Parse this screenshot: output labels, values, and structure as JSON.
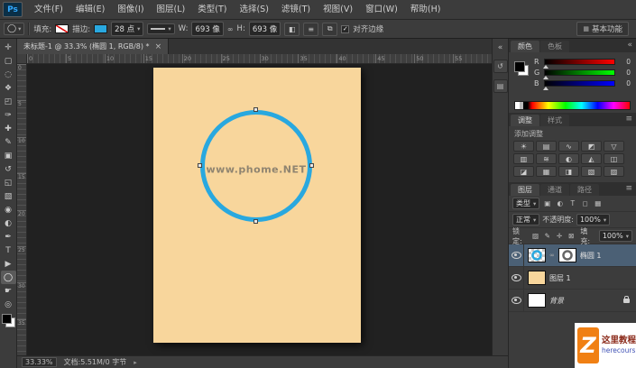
{
  "app": {
    "logo": "Ps",
    "workspace": "基本功能"
  },
  "menu": {
    "items": [
      "文件(F)",
      "编辑(E)",
      "图像(I)",
      "图层(L)",
      "类型(T)",
      "选择(S)",
      "滤镜(T)",
      "视图(V)",
      "窗口(W)",
      "帮助(H)"
    ]
  },
  "options": {
    "fill_label": "填充:",
    "stroke_label": "描边:",
    "stroke_width": "28 点",
    "w_label": "W:",
    "w_value": "693 像",
    "h_label": "H:",
    "h_value": "693 像",
    "align_edges": "对齐边缘"
  },
  "icons": {
    "dropdown": "▾",
    "collapse": "«",
    "menu": "≡",
    "check": "✓",
    "link": "∞",
    "close": "×",
    "arrow_right": "▸",
    "workspace": "▦",
    "ellipse_tool": "◯",
    "path_ops": "◧",
    "path_align": "≡",
    "path_arrange": "⧉"
  },
  "toolbar": {
    "tools": [
      {
        "name": "move",
        "glyph": "✛"
      },
      {
        "name": "rectangular-marquee",
        "glyph": "▢"
      },
      {
        "name": "lasso",
        "glyph": "◌"
      },
      {
        "name": "quick-selection",
        "glyph": "❖"
      },
      {
        "name": "crop",
        "glyph": "◰"
      },
      {
        "name": "eyedropper",
        "glyph": "✑"
      },
      {
        "name": "spot-healing-brush",
        "glyph": "✚"
      },
      {
        "name": "brush",
        "glyph": "✎"
      },
      {
        "name": "clone-stamp",
        "glyph": "▣"
      },
      {
        "name": "history-brush",
        "glyph": "↺"
      },
      {
        "name": "eraser",
        "glyph": "◱"
      },
      {
        "name": "gradient",
        "glyph": "▧"
      },
      {
        "name": "blur",
        "glyph": "◉"
      },
      {
        "name": "dodge",
        "glyph": "◐"
      },
      {
        "name": "pen",
        "glyph": "✒"
      },
      {
        "name": "horizontal-type",
        "glyph": "T"
      },
      {
        "name": "path-selection",
        "glyph": "▶"
      },
      {
        "name": "ellipse-shape",
        "glyph": "◯"
      },
      {
        "name": "hand",
        "glyph": "☛"
      },
      {
        "name": "zoom",
        "glyph": "◎"
      }
    ]
  },
  "doc": {
    "tab_title": "未标题-1 @ 33.3% (椭圆 1, RGB/8) *",
    "watermark": "www.phome.NET",
    "ruler_top": [
      "0",
      "5",
      "10",
      "15",
      "20",
      "25",
      "30",
      "35",
      "40",
      "45",
      "50",
      "55"
    ],
    "ruler_left": [
      "0",
      "5",
      "10",
      "15",
      "20",
      "25",
      "30",
      "35"
    ]
  },
  "strip": {
    "icons": [
      {
        "name": "collapse-dock",
        "glyph": "«"
      },
      {
        "name": "history-panel",
        "glyph": "↺"
      },
      {
        "name": "properties-panel",
        "glyph": "▤"
      }
    ]
  },
  "panels": {
    "color": {
      "tabs": [
        "颜色",
        "色板"
      ],
      "rows": [
        {
          "label": "R",
          "value": "0"
        },
        {
          "label": "G",
          "value": "0"
        },
        {
          "label": "B",
          "value": "0"
        }
      ]
    },
    "adjust": {
      "tabs": [
        "调整",
        "样式"
      ],
      "add_label": "添加调整",
      "icons": [
        {
          "name": "brightness-contrast",
          "glyph": "☀"
        },
        {
          "name": "levels",
          "glyph": "▤"
        },
        {
          "name": "curves",
          "glyph": "∿"
        },
        {
          "name": "exposure",
          "glyph": "◩"
        },
        {
          "name": "vibrance",
          "glyph": "▽"
        },
        {
          "name": "hue-saturation",
          "glyph": "▥"
        },
        {
          "name": "color-balance",
          "glyph": "≋"
        },
        {
          "name": "black-white",
          "glyph": "◐"
        },
        {
          "name": "photo-filter",
          "glyph": "◭"
        },
        {
          "name": "channel-mixer",
          "glyph": "◫"
        },
        {
          "name": "invert",
          "glyph": "◪"
        },
        {
          "name": "posterize",
          "glyph": "▦"
        },
        {
          "name": "threshold",
          "glyph": "◨"
        },
        {
          "name": "gradient-map",
          "glyph": "▧"
        },
        {
          "name": "selective-color",
          "glyph": "▨"
        }
      ]
    },
    "layers": {
      "tabs": [
        "图层",
        "通道",
        "路径"
      ],
      "kind_label": "类型",
      "blend_mode": "正常",
      "opacity_label": "不透明度:",
      "opacity_value": "100%",
      "lock_label": "锁定:",
      "fill_label": "填充:",
      "fill_value": "100%",
      "filter_icons": [
        {
          "name": "filter-pixel-layers",
          "glyph": "▣"
        },
        {
          "name": "filter-adjustment-layers",
          "glyph": "◐"
        },
        {
          "name": "filter-type-layers",
          "glyph": "T"
        },
        {
          "name": "filter-shape-layers",
          "glyph": "◻"
        },
        {
          "name": "filter-smart-objects",
          "glyph": "▦"
        }
      ],
      "lock_icons": [
        {
          "name": "lock-transparent-pixels",
          "glyph": "▨"
        },
        {
          "name": "lock-image-pixels",
          "glyph": "✎"
        },
        {
          "name": "lock-position",
          "glyph": "✛"
        },
        {
          "name": "lock-all",
          "glyph": "⊠"
        }
      ],
      "items": [
        {
          "name": "椭圆 1"
        },
        {
          "name": "图层 1"
        },
        {
          "name": "背景"
        }
      ]
    }
  },
  "status": {
    "zoom": "33.33%",
    "doc_info": "文档:5.51M/0 字节"
  },
  "badge": {
    "logo": "Z",
    "line1": "这里教程网",
    "line2": "herecours.com"
  },
  "colors": {
    "accent_blue": "#29a8df",
    "canvas_peach": "#f8d69c",
    "selected_layer": "#4b6075",
    "badge_orange": "#f08014",
    "badge_red": "#8b2a1a",
    "badge_blue": "#3f51b5"
  }
}
